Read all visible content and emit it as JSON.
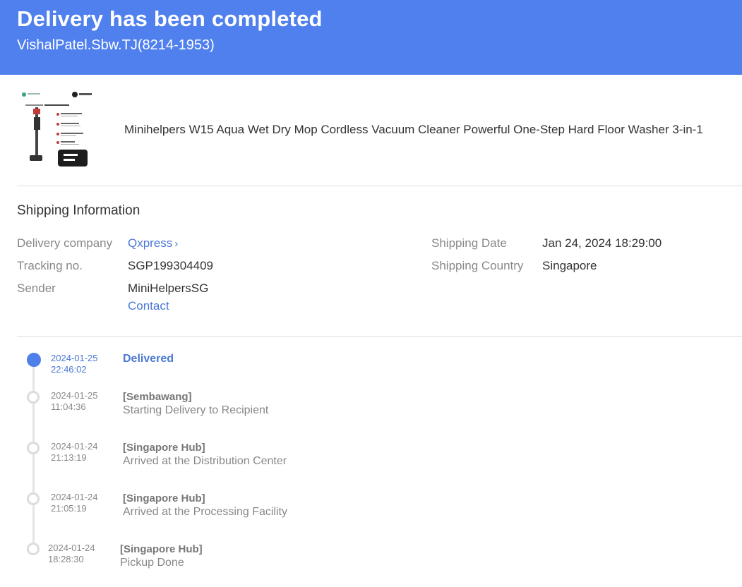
{
  "header": {
    "title": "Delivery has been completed",
    "subtitle": "VishalPatel.Sbw.TJ(8214-1953)",
    "bg_color": "#5080ee"
  },
  "product": {
    "name": "Minihelpers W15 Aqua Wet Dry Mop Cordless Vacuum Cleaner Powerful One-Step Hard Floor Washer 3-in-1",
    "image_icon": "vacuum-product-image"
  },
  "shipping": {
    "section_title": "Shipping Information",
    "company_label": "Delivery company",
    "company_value": "Qxpress",
    "tracking_label": "Tracking no.",
    "tracking_value": "SGP199304409",
    "sender_label": "Sender",
    "sender_value": "MiniHelpersSG",
    "contact_label": "Contact",
    "date_label": "Shipping Date",
    "date_value": "Jan 24, 2024 18:29:00",
    "country_label": "Shipping Country",
    "country_value": "Singapore",
    "link_color": "#4a78d4"
  },
  "timeline": [
    {
      "date": "2024-01-25",
      "time": "22:46:02",
      "location": "Delivered",
      "description": "",
      "active": true
    },
    {
      "date": "2024-01-25",
      "time": "11:04:36",
      "location": "[Sembawang]",
      "description": "Starting Delivery to Recipient",
      "active": false
    },
    {
      "date": "2024-01-24",
      "time": "21:13:19",
      "location": "[Singapore Hub]",
      "description": "Arrived at the Distribution Center",
      "active": false
    },
    {
      "date": "2024-01-24",
      "time": "21:05:19",
      "location": "[Singapore Hub]",
      "description": "Arrived at the Processing Facility",
      "active": false
    },
    {
      "date": "2024-01-24",
      "time": "18:28:30",
      "location": "[Singapore Hub]",
      "description": "Pickup Done",
      "active": false
    }
  ]
}
